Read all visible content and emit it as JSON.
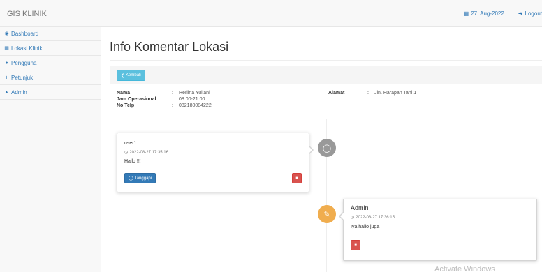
{
  "navbar": {
    "brand": "GIS KLINIK",
    "date": "27. Aug-2022",
    "logout": "Logout",
    "icons": {
      "date": "calendar-icon",
      "logout": "sign-out-icon"
    }
  },
  "sidebar": {
    "items": [
      {
        "label": "Dashboard",
        "icon": "dashboard-icon"
      },
      {
        "label": "Lokasi Klinik",
        "icon": "table-icon"
      },
      {
        "label": "Pengguna",
        "icon": "users-icon"
      },
      {
        "label": "Petunjuk",
        "icon": "info-icon"
      },
      {
        "label": "Admin",
        "icon": "user-icon"
      }
    ]
  },
  "page": {
    "title": "Info Komentar Lokasi",
    "back_button": "Kembali"
  },
  "info": {
    "nama_label": "Nama",
    "nama_value": "Herlina Yuliani",
    "jam_label": "Jam Operasional",
    "jam_value": "08:00-21:00",
    "telp_label": "No Telp",
    "telp_value": "082180084222",
    "alamat_label": "Alamat",
    "alamat_value": "Jln. Harapan Tani 1",
    "colon": ":"
  },
  "timeline": {
    "comments": [
      {
        "user": "user1",
        "time": "2022-08-27 17:35:16",
        "message": "Hallo !!!",
        "reply_button": "Tanggapi",
        "badge_icon": "comment-icon"
      },
      {
        "user": "Admin",
        "time": "2022-08-27 17:36:15",
        "message": "Iya hallo juga",
        "badge_icon": "edit-icon"
      }
    ]
  },
  "watermark": "Activate Windows",
  "colors": {
    "navbar_bg": "#f8f8f8",
    "link": "#337ab7",
    "info_button": "#5bc0de",
    "primary_button": "#337ab7",
    "danger_button": "#d9534f",
    "badge_comment": "#999999",
    "badge_admin": "#f0ad4e"
  }
}
